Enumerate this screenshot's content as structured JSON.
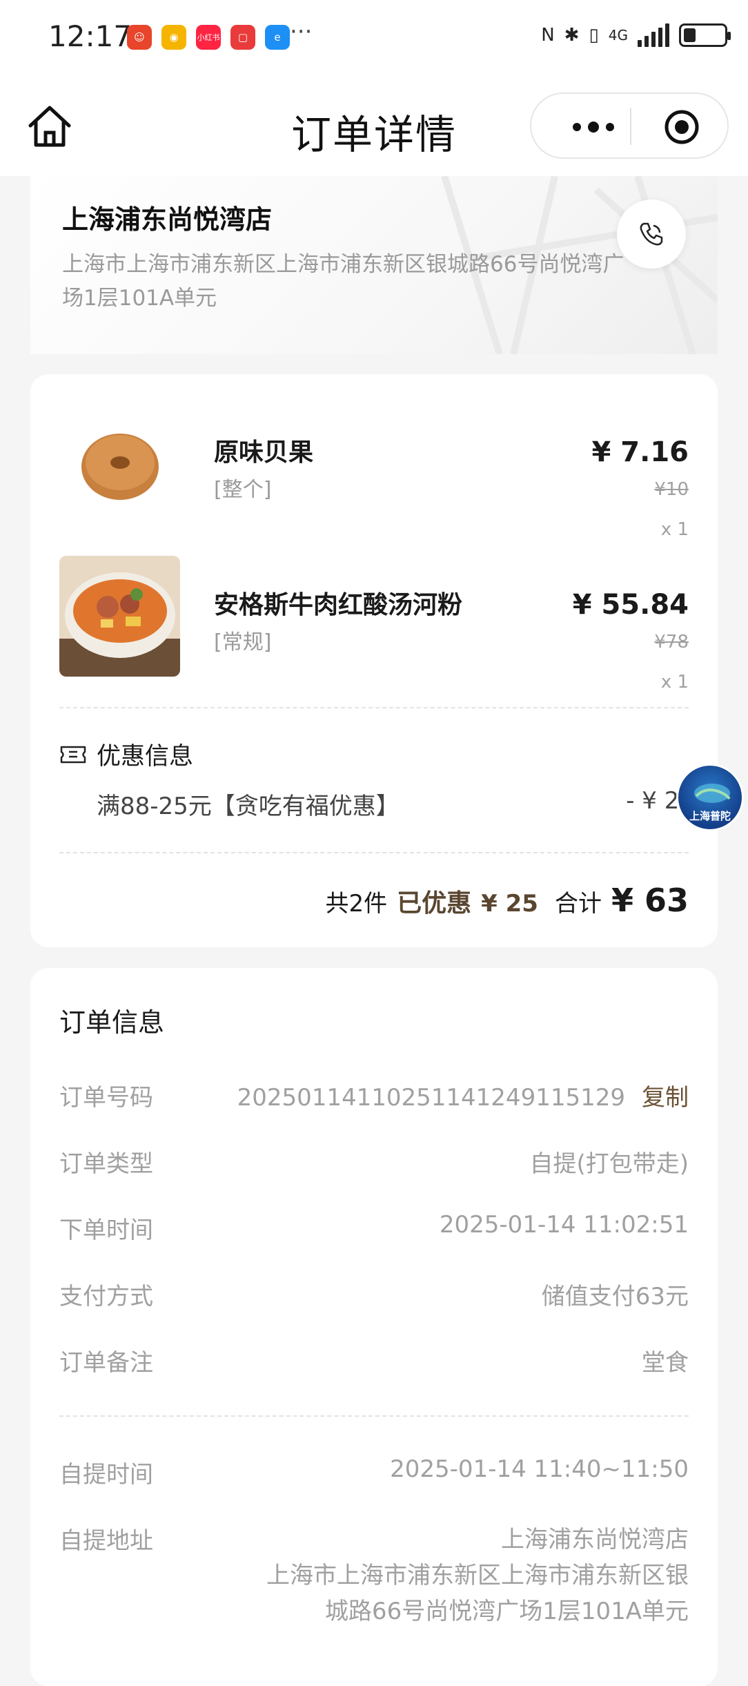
{
  "status_bar": {
    "time": "12:17",
    "more": "···",
    "network": "4G",
    "battery_level": 0.3,
    "apps": [
      {
        "icon": "app-icon-red-cartoon",
        "color": "#e8452c",
        "label": ""
      },
      {
        "icon": "weibo-icon",
        "color": "#f5b400",
        "label": ""
      },
      {
        "icon": "xiaohongshu-icon",
        "color": "#ff2442",
        "label": "小红书"
      },
      {
        "icon": "red-square-app-icon",
        "color": "#e93b3b",
        "label": ""
      },
      {
        "icon": "eleme-icon",
        "color": "#1e8ff5",
        "label": ""
      }
    ]
  },
  "nav": {
    "title": "订单详情",
    "home_icon": "home-icon",
    "more_icon": "more-dots-icon",
    "close_icon": "target-close-icon"
  },
  "store": {
    "name": "上海浦东尚悦湾店",
    "address": "上海市上海市浦东新区上海市浦东新区银城路66号尚悦湾广场1层101A单元",
    "phone_icon": "phone-icon"
  },
  "items": [
    {
      "name": "原味贝果",
      "spec": "[整个]",
      "price": "¥ 7.16",
      "original_price": "¥10",
      "qty": "x 1",
      "image": "bagel-image"
    },
    {
      "name": "安格斯牛肉红酸汤河粉",
      "spec": "[常规]",
      "price": "¥ 55.84",
      "original_price": "¥78",
      "qty": "x 1",
      "image": "noodle-bowl-image"
    }
  ],
  "promo": {
    "title": "优惠信息",
    "icon": "coupon-icon",
    "description": "满88-25元【贪吃有福优惠】",
    "amount": "- ¥ 25"
  },
  "summary": {
    "count": "共2件",
    "saved_label": "已优惠",
    "saved_value": "¥ 25",
    "total_label": "合计",
    "total_value": "¥ 63"
  },
  "floating_badge": {
    "text": "上海普陀"
  },
  "order_info": {
    "heading": "订单信息",
    "copy_label": "复制",
    "rows": [
      {
        "label": "订单号码",
        "value": "2025011411025114124911512​9"
      },
      {
        "label": "订单类型",
        "value": "自提(打包带走)"
      },
      {
        "label": "下单时间",
        "value": "2025-01-14 11:02:51"
      },
      {
        "label": "支付方式",
        "value": "储值支付63元"
      },
      {
        "label": "订单备注",
        "value": "堂食"
      }
    ],
    "pickup_time_label": "自提时间",
    "pickup_time_value": "2025-01-14 11:40~11:50",
    "pickup_addr_label": "自提地址",
    "pickup_addr_line1": "上海浦东尚悦湾店",
    "pickup_addr_line2": "上海市上海市浦东新区上海市浦东新区银",
    "pickup_addr_line3": "城路66号尚悦湾广场1层101A单元"
  }
}
